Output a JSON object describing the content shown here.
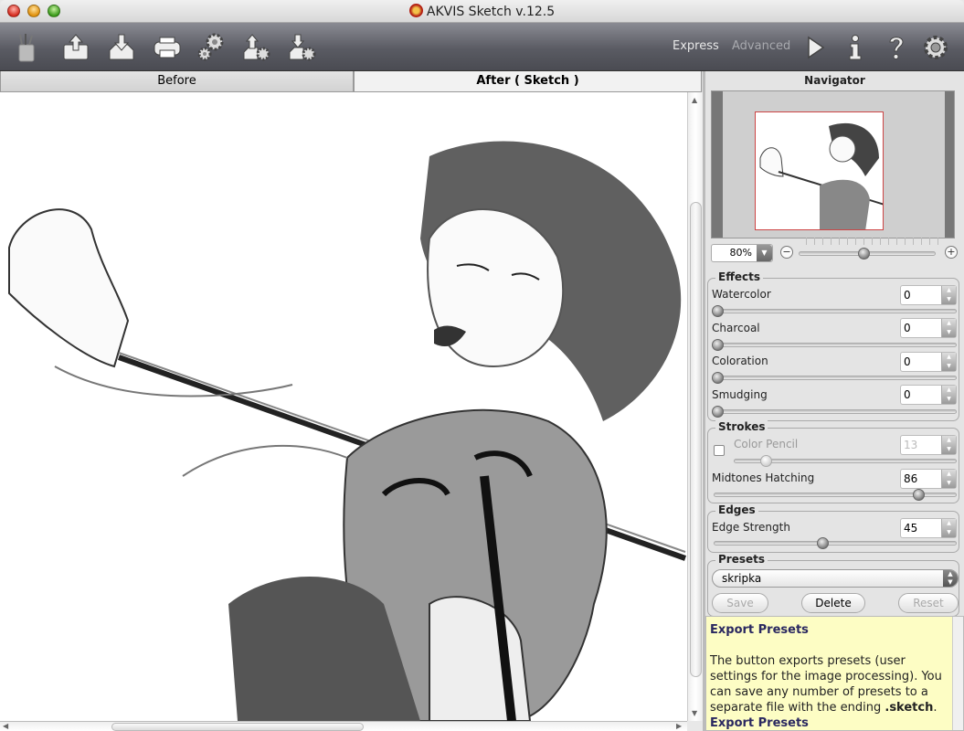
{
  "window": {
    "title": "AKVIS Sketch v.12.5"
  },
  "toolbar": {
    "buttons": [
      {
        "name": "logo-pencils",
        "icon": "pencil-cup-icon"
      },
      {
        "name": "open-image",
        "icon": "upload-tray-icon"
      },
      {
        "name": "save-image",
        "icon": "download-tray-icon"
      },
      {
        "name": "print",
        "icon": "printer-icon"
      },
      {
        "name": "preferences-batch",
        "icon": "gears-icon"
      },
      {
        "name": "import-presets",
        "icon": "upload-gear-icon"
      },
      {
        "name": "export-presets",
        "icon": "download-gear-icon"
      }
    ],
    "mode_express": "Express",
    "mode_advanced": "Advanced",
    "right_buttons": [
      {
        "name": "run",
        "icon": "play-icon"
      },
      {
        "name": "about",
        "icon": "info-icon"
      },
      {
        "name": "help",
        "icon": "question-icon"
      },
      {
        "name": "settings",
        "icon": "gear-icon"
      }
    ]
  },
  "tabs": {
    "before": "Before",
    "after": "After ( Sketch )",
    "active": "after"
  },
  "navigator": {
    "title": "Navigator",
    "zoom": "80%",
    "zoom_slider": 0.47
  },
  "effects": {
    "title": "Effects",
    "params": [
      {
        "label": "Watercolor",
        "value": "0"
      },
      {
        "label": "Charcoal",
        "value": "0"
      },
      {
        "label": "Coloration",
        "value": "0"
      },
      {
        "label": "Smudging",
        "value": "0"
      }
    ]
  },
  "strokes": {
    "title": "Strokes",
    "color_pencil": {
      "label": "Color Pencil",
      "value": "13",
      "checked": false,
      "enabled": false
    },
    "midtones": {
      "label": "Midtones Hatching",
      "value": "86"
    }
  },
  "edges": {
    "title": "Edges",
    "strength": {
      "label": "Edge Strength",
      "value": "45"
    }
  },
  "presets": {
    "title": "Presets",
    "selected": "skripka",
    "save": "Save",
    "delete": "Delete",
    "reset": "Reset"
  },
  "help": {
    "heading": "Export Presets",
    "body": "The button exports presets (user settings for the image processing). You can save any number of presets to a separate file with the ending ",
    "ext": ".sketch",
    "body_end": ".",
    "heading2": "Export Presets"
  }
}
